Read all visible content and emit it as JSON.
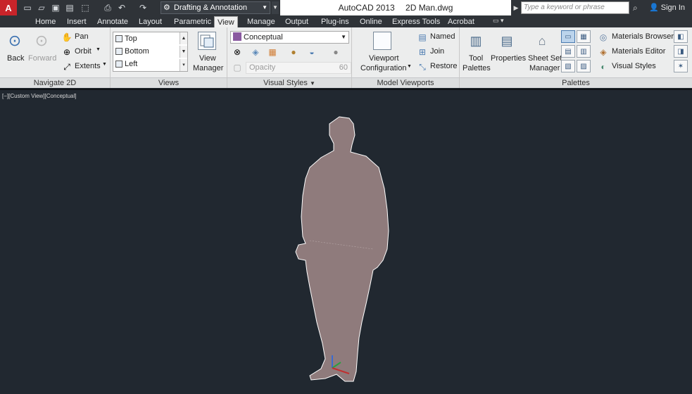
{
  "titlebar": {
    "app_button": "A",
    "workspace": "Drafting & Annotation",
    "app_name": "AutoCAD 2013",
    "doc_name": "2D Man.dwg",
    "search_placeholder": "Type a keyword or phrase",
    "signin": "Sign In"
  },
  "tabs": [
    "Home",
    "Insert",
    "Annotate",
    "Layout",
    "Parametric",
    "View",
    "Manage",
    "Output",
    "Plug-ins",
    "Online",
    "Express Tools",
    "Acrobat"
  ],
  "active_tab": "View",
  "ribbon": {
    "navigate2d": {
      "title": "Navigate 2D",
      "back": "Back",
      "forward": "Forward",
      "pan": "Pan",
      "orbit": "Orbit",
      "extents": "Extents"
    },
    "views": {
      "title": "Views",
      "items": [
        "Top",
        "Bottom",
        "Left"
      ],
      "view_manager_1": "View",
      "view_manager_2": "Manager"
    },
    "visual_styles": {
      "title": "Visual Styles",
      "current": "Conceptual",
      "opacity_label": "Opacity",
      "opacity_value": "60"
    },
    "model_viewports": {
      "title": "Model Viewports",
      "config_1": "Viewport",
      "config_2": "Configuration",
      "named": "Named",
      "join": "Join",
      "restore": "Restore"
    },
    "palettes": {
      "title": "Palettes",
      "tool_1": "Tool",
      "tool_2": "Palettes",
      "properties": "Properties",
      "ssm_1": "Sheet Set",
      "ssm_2": "Manager",
      "materials_browser": "Materials Browser",
      "materials_editor": "Materials Editor",
      "visual_styles": "Visual Styles"
    }
  },
  "viewport": {
    "label": "[−][Custom View][Conceptual]"
  },
  "colors": {
    "titlebar": "#2f3338",
    "ribbon": "#eceded",
    "viewport_bg": "#212830",
    "figure": "#8f7b7c",
    "app_red": "#c8242a"
  }
}
